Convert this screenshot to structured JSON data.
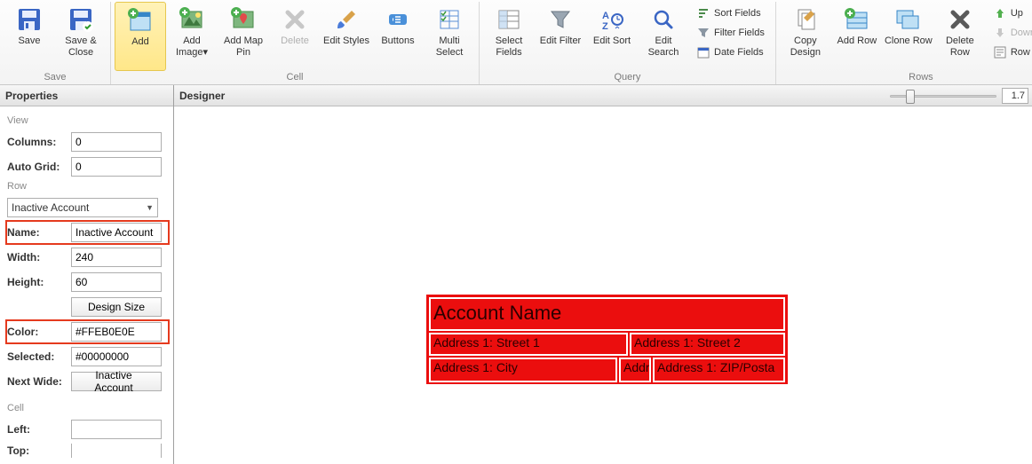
{
  "ribbon": {
    "save": {
      "save": "Save",
      "save_close": "Save & Close",
      "group": "Save"
    },
    "cell": {
      "add": "Add",
      "add_image": "Add Image▾",
      "add_map": "Add Map Pin",
      "delete": "Delete",
      "edit_styles": "Edit Styles",
      "buttons": "Buttons",
      "multi_select": "Multi Select",
      "group": "Cell"
    },
    "query": {
      "select_fields": "Select Fields",
      "edit_filter": "Edit Filter",
      "edit_sort": "Edit Sort",
      "edit_search": "Edit Search",
      "sort_fields": "Sort Fields",
      "filter_fields": "Filter Fields",
      "date_fields": "Date Fields",
      "group": "Query"
    },
    "rows": {
      "copy_design": "Copy Design",
      "add_row": "Add Row",
      "clone_row": "Clone Row",
      "delete_row": "Delete Row",
      "up": "Up",
      "down": "Down",
      "row_script": "Row Scrip",
      "group": "Rows"
    }
  },
  "panels": {
    "properties": "Properties",
    "designer": "Designer"
  },
  "zoom": "1.7",
  "props": {
    "view_section": "View",
    "columns": {
      "label": "Columns:",
      "value": "0"
    },
    "autogrid": {
      "label": "Auto Grid:",
      "value": "0"
    },
    "row_section": "Row",
    "row_select": "Inactive Account",
    "name": {
      "label": "Name:",
      "value": "Inactive Account"
    },
    "width": {
      "label": "Width:",
      "value": "240"
    },
    "height": {
      "label": "Height:",
      "value": "60"
    },
    "design_size": "Design Size",
    "color": {
      "label": "Color:",
      "value": "#FFEB0E0E"
    },
    "selected": {
      "label": "Selected:",
      "value": "#00000000"
    },
    "nextwide": {
      "label": "Next Wide:",
      "value": "Inactive Account"
    },
    "cell_section": "Cell",
    "left": {
      "label": "Left:",
      "value": ""
    },
    "top": {
      "label": "Top:",
      "value": ""
    }
  },
  "rowcard": {
    "title": "Account Name",
    "s1": "Address 1: Street 1",
    "s2": "Address 1: Street 2",
    "city": "Address 1: City",
    "st": "Addr",
    "zip": "Address 1: ZIP/Posta"
  }
}
